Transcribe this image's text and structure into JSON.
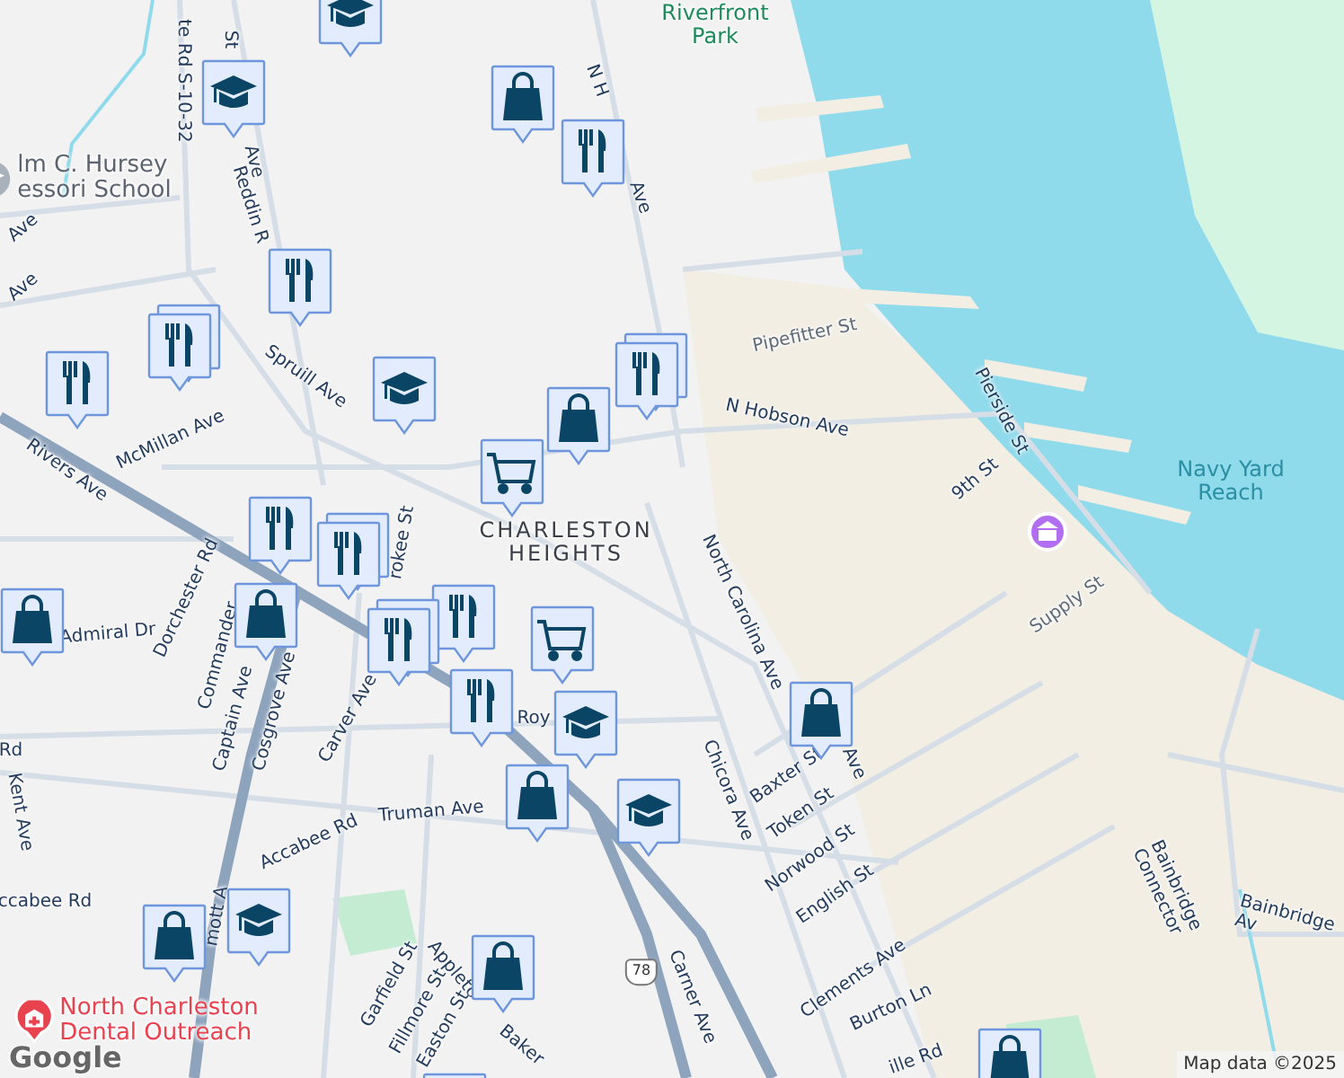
{
  "labels": [
    {
      "text": "Riverfront\nPark",
      "kind": "park"
    },
    {
      "text": "te Rd S-10-32",
      "kind": "road"
    },
    {
      "text": "St",
      "kind": "road"
    },
    {
      "text": "Ave",
      "kind": "road"
    },
    {
      "text": "N H",
      "kind": "road"
    },
    {
      "text": "Ave",
      "kind": "road"
    },
    {
      "text": "lm C. Hursey\nessori School",
      "kind": "school"
    },
    {
      "text": "Reddin R",
      "kind": "road"
    },
    {
      "text": "Ave",
      "kind": "road"
    },
    {
      "text": "Ave",
      "kind": "road"
    },
    {
      "text": "Pipefitter St",
      "kind": "minor"
    },
    {
      "text": "Spruill Ave",
      "kind": "road"
    },
    {
      "text": "N Hobson Ave",
      "kind": "road"
    },
    {
      "text": "Pierside St",
      "kind": "road"
    },
    {
      "text": "McMillan Ave",
      "kind": "road"
    },
    {
      "text": "Rivers Ave",
      "kind": "road"
    },
    {
      "text": "9th St",
      "kind": "road"
    },
    {
      "text": "Navy Yard\nReach",
      "kind": "water"
    },
    {
      "text": "CHARLESTON\nHEIGHTS",
      "kind": "district"
    },
    {
      "text": "rokee St",
      "kind": "road"
    },
    {
      "text": "Supply St",
      "kind": "minor"
    },
    {
      "text": "North Carolina Ave",
      "kind": "road"
    },
    {
      "text": "Admiral Dr",
      "kind": "road"
    },
    {
      "text": "Dorchester Rd",
      "kind": "road"
    },
    {
      "text": "Commander",
      "kind": "road"
    },
    {
      "text": "Captain Ave",
      "kind": "road"
    },
    {
      "text": "Cosgrove Ave",
      "kind": "road"
    },
    {
      "text": "Carver Ave",
      "kind": "road"
    },
    {
      "text": "Roy",
      "kind": "road"
    },
    {
      "text": "Rd",
      "kind": "road"
    },
    {
      "text": "Baxter St",
      "kind": "road"
    },
    {
      "text": "Ave",
      "kind": "road"
    },
    {
      "text": "Chicora Ave",
      "kind": "road"
    },
    {
      "text": "Truman Ave",
      "kind": "road"
    },
    {
      "text": "Kent Ave",
      "kind": "road"
    },
    {
      "text": "Token St",
      "kind": "road"
    },
    {
      "text": "Accabee Rd",
      "kind": "road"
    },
    {
      "text": "Norwood St",
      "kind": "road"
    },
    {
      "text": "English St",
      "kind": "road"
    },
    {
      "text": "ccabee Rd",
      "kind": "road"
    },
    {
      "text": "Bainbridge Connector",
      "kind": "road"
    },
    {
      "text": "Bainbridge Av",
      "kind": "road"
    },
    {
      "text": "mott A",
      "kind": "road"
    },
    {
      "text": "Appleto",
      "kind": "road"
    },
    {
      "text": "Clements Ave",
      "kind": "road"
    },
    {
      "text": "78",
      "kind": "shield"
    },
    {
      "text": "Garfield St",
      "kind": "road"
    },
    {
      "text": "Carner Ave",
      "kind": "road"
    },
    {
      "text": "Burton Ln",
      "kind": "road"
    },
    {
      "text": "North Charleston\nDental Outreach",
      "kind": "hospital"
    },
    {
      "text": "Fillmore St",
      "kind": "road"
    },
    {
      "text": "Easton St",
      "kind": "road"
    },
    {
      "text": "Baker",
      "kind": "road"
    },
    {
      "text": "ille Rd",
      "kind": "road"
    }
  ],
  "pins": [
    {
      "kind": "school",
      "stacked": false
    },
    {
      "kind": "school",
      "stacked": false
    },
    {
      "kind": "shop",
      "stacked": false
    },
    {
      "kind": "food",
      "stacked": false
    },
    {
      "kind": "food",
      "stacked": false
    },
    {
      "kind": "food",
      "stacked": true
    },
    {
      "kind": "food",
      "stacked": false
    },
    {
      "kind": "school",
      "stacked": false
    },
    {
      "kind": "food",
      "stacked": true
    },
    {
      "kind": "shop",
      "stacked": false
    },
    {
      "kind": "cart",
      "stacked": false
    },
    {
      "kind": "food",
      "stacked": false
    },
    {
      "kind": "food",
      "stacked": true
    },
    {
      "kind": "shop",
      "stacked": false
    },
    {
      "kind": "shop",
      "stacked": false
    },
    {
      "kind": "food",
      "stacked": false
    },
    {
      "kind": "food",
      "stacked": true
    },
    {
      "kind": "cart",
      "stacked": false
    },
    {
      "kind": "food",
      "stacked": false
    },
    {
      "kind": "school",
      "stacked": false
    },
    {
      "kind": "shop",
      "stacked": false
    },
    {
      "kind": "shop",
      "stacked": false
    },
    {
      "kind": "school",
      "stacked": false
    },
    {
      "kind": "school",
      "stacked": false
    },
    {
      "kind": "shop",
      "stacked": false
    },
    {
      "kind": "shop",
      "stacked": false
    },
    {
      "kind": "shop",
      "stacked": false
    },
    {
      "kind": "shop",
      "stacked": false
    },
    {
      "kind": "landmark",
      "stacked": false
    }
  ],
  "attribution": "Map data ©2025",
  "logo": "Google"
}
